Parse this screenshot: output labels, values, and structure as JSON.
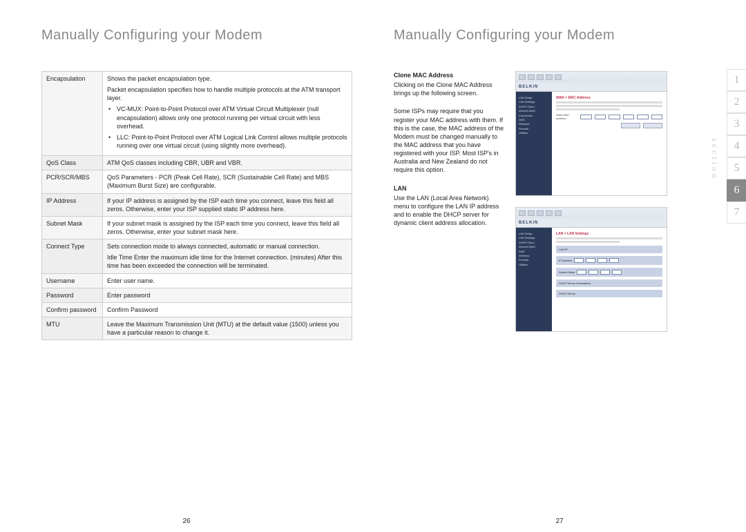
{
  "left": {
    "title": "Manually Configuring your Modem",
    "page_num": "26",
    "table": {
      "encapsulation": {
        "label": "Encapsulation",
        "line1": "Shows the packet encapsulation type.",
        "line2": "Packet encapsulation specifies how to handle multiple protocols at the ATM transport layer.",
        "bullet1": "VC-MUX: Point-to-Point Protocol over ATM Virtual Circuit Multiplexer (null encapsulation) allows only one protocol running per virtual circuit with less overhead.",
        "bullet2": "LLC: Point-to-Point Protocol over ATM Logical Link Control allows multiple protocols running over one virtual circuit (using slightly more overhead)."
      },
      "qos": {
        "label": "QoS Class",
        "desc": "ATM QoS classes including CBR, UBR and VBR."
      },
      "pcr": {
        "label": "PCR/SCR/MBS",
        "desc": "QoS Parameters - PCR (Peak Cell Rate), SCR (Sustainable Cell Rate) and MBS (Maximum Burst Size) are configurable."
      },
      "ip": {
        "label": "IP Address",
        "desc": "If your IP address is assigned by the ISP each time you connect, leave this field all zeros. Otherwise, enter your ISP supplied static IP address here."
      },
      "subnet": {
        "label": "Subnet Mask",
        "desc": "If your subnet mask is assigned by the ISP each time you connect, leave this field all zeros. Otherwise, enter your subnet mask here."
      },
      "connect": {
        "label": "Connect Type",
        "desc1": "Sets connection mode to always connected, automatic or manual connection.",
        "desc2": "Idle Time Enter the maximum idle time for the Internet connection. (minutes) After this time has been exceeded the connection will be terminated."
      },
      "username": {
        "label": "Username",
        "desc": "Enter user name."
      },
      "password": {
        "label": "Password",
        "desc": "Enter password"
      },
      "confirm": {
        "label": "Confirm password",
        "desc": "Confirm Password"
      },
      "mtu": {
        "label": "MTU",
        "desc": "Leave the Maximum Transmission Unit (MTU) at the default value (1500) unless you have a particular reason to change it."
      }
    }
  },
  "right": {
    "title": "Manually Configuring your Modem",
    "page_num": "27",
    "clone": {
      "heading": "Clone MAC Address",
      "p1": "Clicking on the Clone MAC Address brings up the following screen.",
      "p2": "Some ISPs may require that you register your MAC address with them. If this is the case, the MAC address of the Modem must be changed manually to the MAC address that you have registered with your ISP.  Most ISP's in Australia and New Zealand do not require this option."
    },
    "lan": {
      "heading": "LAN",
      "p1": "Use the LAN (Local Area Network) menu to configure the LAN IP address and to enable the DHCP server for dynamic client address allocation."
    },
    "thumb_brand": "BELKIN",
    "section_label": "section",
    "tabs": [
      "1",
      "2",
      "3",
      "4",
      "5",
      "6",
      "7"
    ],
    "active_tab": "6"
  }
}
